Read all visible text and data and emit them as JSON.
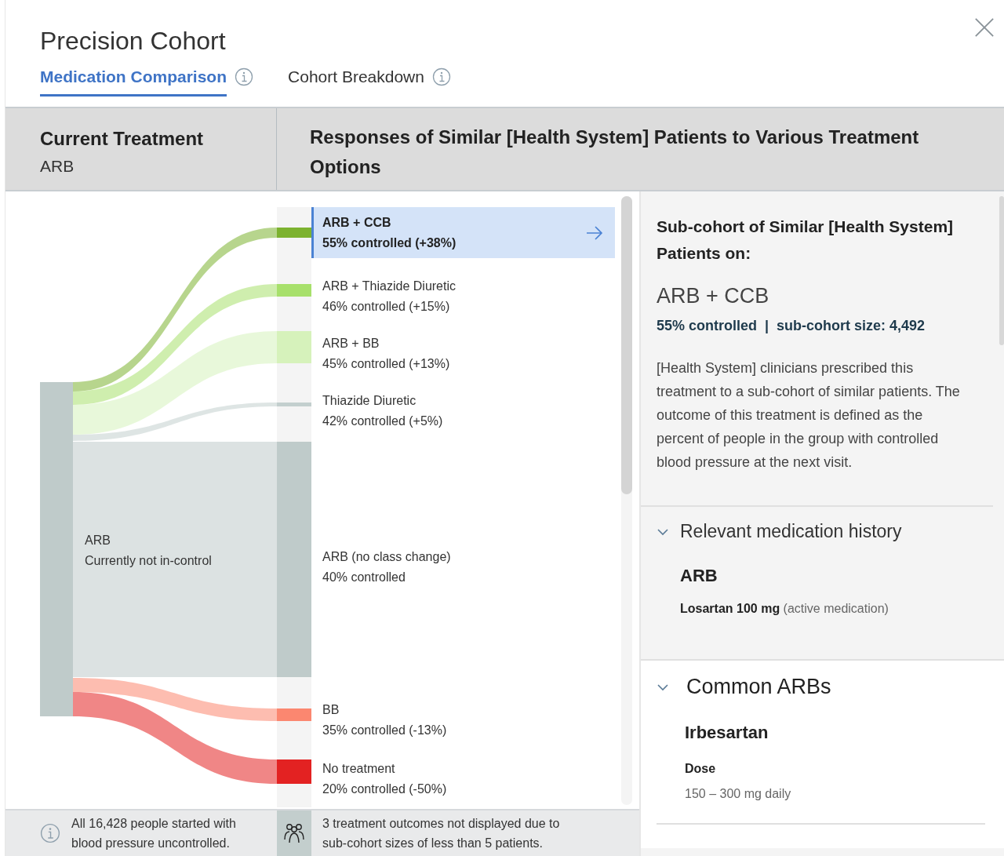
{
  "dialog": {
    "title": "Precision Cohort"
  },
  "tabs": [
    {
      "label": "Medication Comparison",
      "selected": true
    },
    {
      "label": "Cohort Breakdown",
      "selected": false
    }
  ],
  "header": {
    "current_title": "Current Treatment",
    "current_value": "ARB",
    "responses_title": "Responses of Similar [Health System] Patients to Various Treatment Options"
  },
  "sankey": {
    "source": {
      "name": "ARB",
      "status": "Currently not in-control"
    },
    "options": [
      {
        "name": "ARB + CCB",
        "outcome": "55% controlled (+38%)",
        "selected": true,
        "color": "#7cb22f"
      },
      {
        "name": "ARB + Thiazide Diuretic",
        "outcome": "46% controlled (+15%)",
        "selected": false,
        "color": "#a7e06b"
      },
      {
        "name": "ARB + BB",
        "outcome": "45% controlled (+13%)",
        "selected": false,
        "color": "#d6f2bb"
      },
      {
        "name": "Thiazide Diuretic",
        "outcome": "42% controlled (+5%)",
        "selected": false,
        "color": "#c3cfce"
      },
      {
        "name": "ARB (no class change)",
        "outcome": "40% controlled",
        "selected": false,
        "color": "#bfcbca"
      },
      {
        "name": "BB",
        "outcome": "35% controlled (-13%)",
        "selected": false,
        "color": "#fb8770"
      },
      {
        "name": "No treatment",
        "outcome": "20% controlled (-50%)",
        "selected": false,
        "color": "#e32222"
      }
    ]
  },
  "footer": {
    "total_note": "All 16,428 people started with blood pressure uncontrolled.",
    "hidden_note": "3 treatment outcomes not displayed due to sub-cohort sizes of less than 5 patients."
  },
  "detail": {
    "heading": "Sub-cohort of Similar [Health System] Patients on:",
    "treatment": "ARB + CCB",
    "stats": "55% controlled  |  sub-cohort size: 4,492",
    "description": "[Health System] clinicians prescribed this treatment to a sub-cohort of similar patients. The outcome of this treatment is defined as the percent of people in the group with controlled blood pressure at the next visit.",
    "sections": [
      {
        "kind": "history",
        "title": "Relevant medication history",
        "expanded": true,
        "items": [
          {
            "name": "ARB",
            "detail": "**Losartan 100 mg** (active medication)"
          }
        ]
      },
      {
        "kind": "drug",
        "title": "Common ARBs",
        "expanded": true,
        "items": [
          {
            "name": "Irbesartan",
            "label": "Dose",
            "detail": "150 – 300 mg daily"
          }
        ]
      }
    ]
  }
}
